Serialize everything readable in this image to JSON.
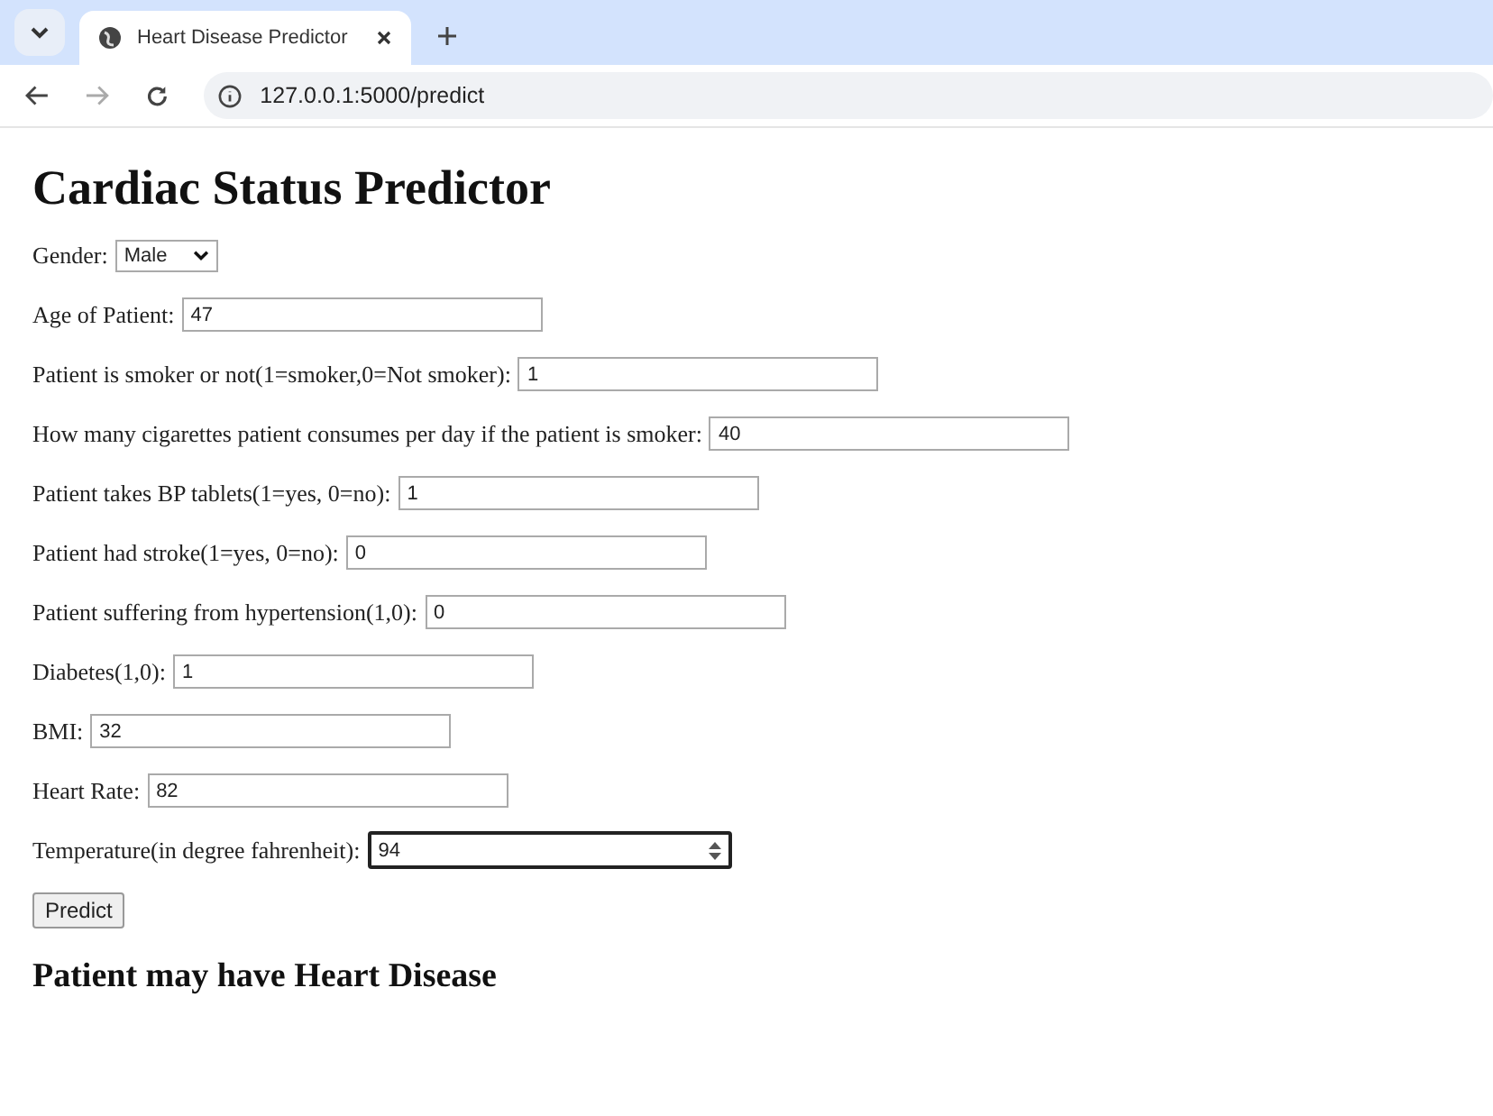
{
  "browser": {
    "tab_title": "Heart Disease Predictor",
    "url": "127.0.0.1:5000/predict"
  },
  "page": {
    "title": "Cardiac Status Predictor",
    "fields": [
      {
        "kind": "select",
        "label": "Gender:",
        "value": "Male",
        "focused": false
      },
      {
        "kind": "text",
        "label": "Age of Patient:",
        "value": "47",
        "focused": false
      },
      {
        "kind": "text",
        "label": "Patient is smoker or not(1=smoker,0=Not smoker):",
        "value": "1",
        "focused": false
      },
      {
        "kind": "text",
        "label": "How many cigarettes patient consumes per day if the patient is smoker:",
        "value": "40",
        "focused": false
      },
      {
        "kind": "text",
        "label": "Patient takes BP tablets(1=yes, 0=no):",
        "value": "1",
        "focused": false
      },
      {
        "kind": "text",
        "label": "Patient had stroke(1=yes, 0=no):",
        "value": "0",
        "focused": false
      },
      {
        "kind": "text",
        "label": "Patient suffering from hypertension(1,0):",
        "value": "0",
        "focused": false
      },
      {
        "kind": "text",
        "label": "Diabetes(1,0):",
        "value": "1",
        "focused": false
      },
      {
        "kind": "text",
        "label": "BMI:",
        "value": "32",
        "focused": false
      },
      {
        "kind": "text",
        "label": "Heart Rate:",
        "value": "82",
        "focused": false
      },
      {
        "kind": "number",
        "label": "Temperature(in degree fahrenheit):",
        "value": "94",
        "focused": true
      }
    ],
    "button": "Predict",
    "result": "Patient may have Heart Disease"
  }
}
